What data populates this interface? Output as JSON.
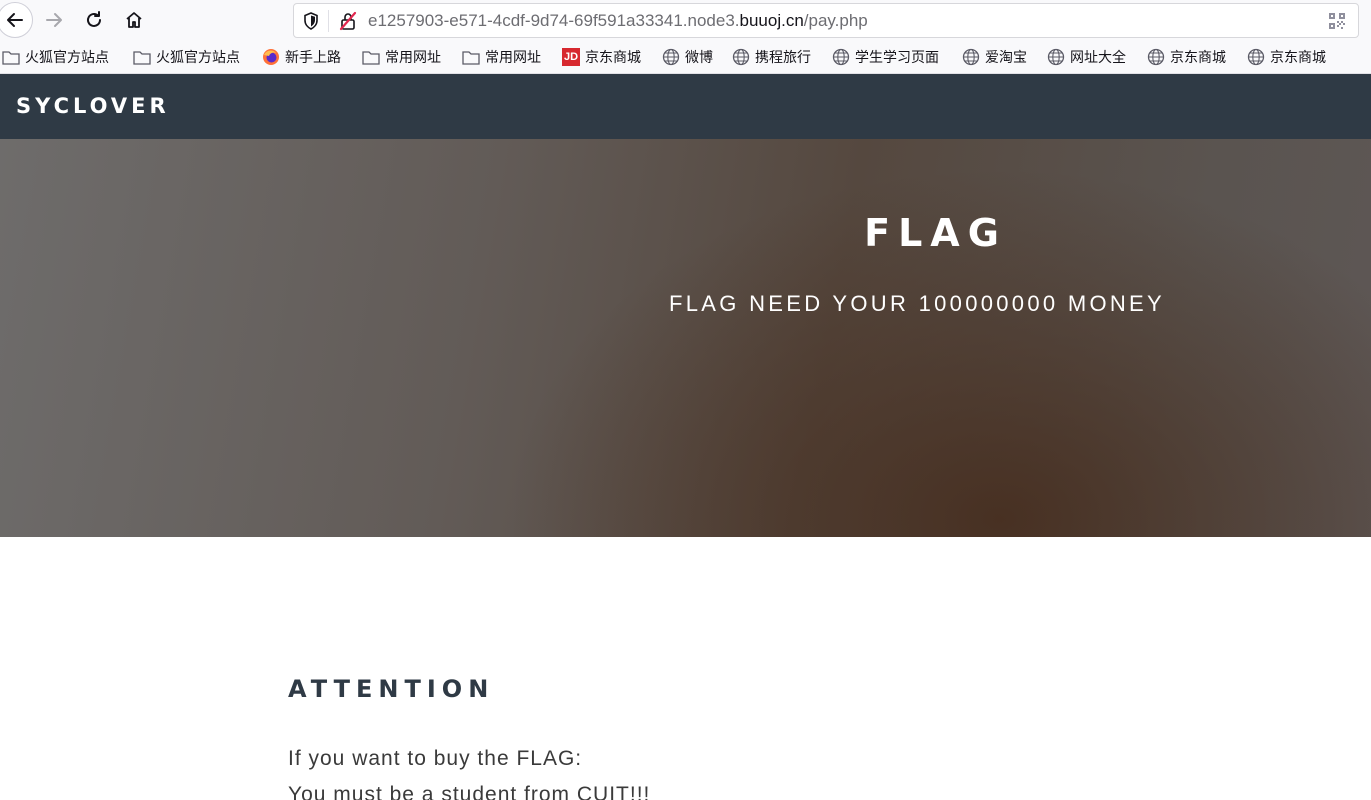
{
  "browser": {
    "url_prefix": "e1257903-e571-4cdf-9d74-69f591a33341.node3.",
    "url_host": "buuoj.cn",
    "url_path": "/pay.php"
  },
  "bookmarks": [
    {
      "label": "火狐官方站点",
      "icon": "folder-icon"
    },
    {
      "label": "火狐官方站点",
      "icon": "folder-icon"
    },
    {
      "label": "新手上路",
      "icon": "firefox-icon"
    },
    {
      "label": "常用网址",
      "icon": "folder-icon"
    },
    {
      "label": "常用网址",
      "icon": "folder-icon"
    },
    {
      "label": "京东商城",
      "icon": "jd-icon",
      "icon_text": "JD"
    },
    {
      "label": "微博",
      "icon": "globe-icon"
    },
    {
      "label": "携程旅行",
      "icon": "globe-icon"
    },
    {
      "label": "学生学习页面",
      "icon": "globe-icon"
    },
    {
      "label": "爱淘宝",
      "icon": "globe-icon"
    },
    {
      "label": "网址大全",
      "icon": "globe-icon"
    },
    {
      "label": "京东商城",
      "icon": "globe-icon"
    },
    {
      "label": "京东商城",
      "icon": "globe-icon"
    }
  ],
  "site": {
    "brand": "SYCLOVER",
    "hero_title": "FLAG",
    "hero_subtitle": "FLAG NEED YOUR 100000000 MONEY",
    "section_title": "ATTENTION",
    "line1": "If you want to buy the FLAG:",
    "line2": "You must be a student from CUIT!!!"
  },
  "colors": {
    "navbar": "#2f3a45",
    "heading": "#2f3a45",
    "jd_red": "#d7282f"
  }
}
